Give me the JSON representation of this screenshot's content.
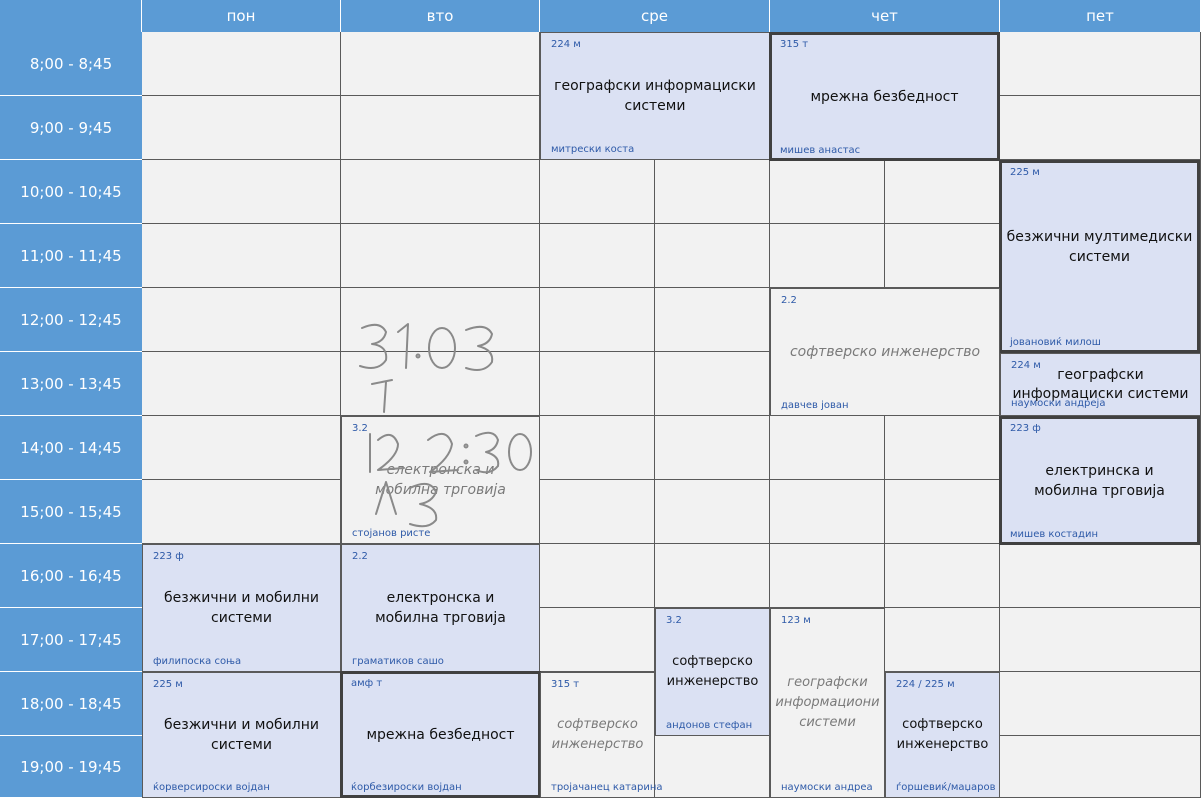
{
  "days": [
    "пон",
    "вто",
    "сре",
    "чет",
    "пет"
  ],
  "times": [
    "8;00 - 8;45",
    "9;00 - 9;45",
    "10;00 - 10;45",
    "11;00 - 11;45",
    "12;00 - 12;45",
    "13;00 - 13;45",
    "14;00 - 14;45",
    "15;00 - 15;45",
    "16;00 - 16;45",
    "17;00 - 17;45",
    "18;00 - 18;45",
    "19;00 - 19;45"
  ],
  "colors": {
    "header": "#5b9bd5",
    "event_fill": "#dbe1f3",
    "empty_cell": "#f2f2f2",
    "room_text": "#2e5aa8"
  },
  "events": [
    {
      "id": "sre-geo",
      "room": "224 м",
      "title": "географски информациски системи",
      "teacher": "митрески коста",
      "style": "normal"
    },
    {
      "id": "chet-mrezna",
      "room": "315 т",
      "title": "мрежна безбедност",
      "teacher": "мишев анастас",
      "style": "bold"
    },
    {
      "id": "pet-bezicni-multimedia",
      "room": "225 м",
      "title": "безжични мултимедиски системи",
      "teacher": "јовановиќ милош",
      "style": "bold"
    },
    {
      "id": "chet-softver",
      "room": "2.2",
      "title": "софтверско инженерство",
      "teacher": "давчев јован",
      "style": "italic"
    },
    {
      "id": "pet-geo",
      "room": "224 м",
      "title": "географски информациски системи",
      "teacher": "наумоски андреја",
      "style": "normal"
    },
    {
      "id": "vto-el-trgovija",
      "room": "3.2",
      "title": "електронска и мобилна трговија",
      "teacher": "стојанов ристе",
      "style": "italic"
    },
    {
      "id": "pet-el-trgovija",
      "room": "223 ф",
      "title": "електринска и мобилна трговија",
      "teacher": "мишев костадин",
      "style": "bold"
    },
    {
      "id": "pon-bezicni-16",
      "room": "223 ф",
      "title": "безжични и мобилни системи",
      "teacher": "филипоска соња",
      "style": "normal"
    },
    {
      "id": "vto-el-trgovija-16",
      "room": "2.2",
      "title": "електронска и мобилна трговија",
      "teacher": "граматиков сашо",
      "style": "normal"
    },
    {
      "id": "sre-softver-17",
      "room": "3.2",
      "title": "софтверско инженерство",
      "teacher": "андонов стефан",
      "style": "normal"
    },
    {
      "id": "chet-geo-17",
      "room": "123 м",
      "title": "географски информациони системи",
      "teacher": "наумоски андреа",
      "style": "italic"
    },
    {
      "id": "pon-bezicni-18",
      "room": "225 м",
      "title": "безжични и мобилни системи",
      "teacher": "ќорверсироски војдан",
      "style": "normal"
    },
    {
      "id": "vto-mrezna-18",
      "room": "амф т",
      "title": "мрежна безбедност",
      "teacher": "ќорбезироски војдан",
      "style": "bold"
    },
    {
      "id": "sre-softver-18",
      "room": "315 т",
      "title": "софтверско инженерство",
      "teacher": "тројачанец катарина",
      "style": "italic"
    },
    {
      "id": "chet-softver-18",
      "room": "224 / 225 м",
      "title": "софтверско инженерство",
      "teacher": "ѓоршевиќ/маџаров",
      "style": "normal"
    }
  ],
  "handwriting": {
    "lines": [
      "31.03",
      "↑",
      "12:30",
      "Л3"
    ]
  }
}
